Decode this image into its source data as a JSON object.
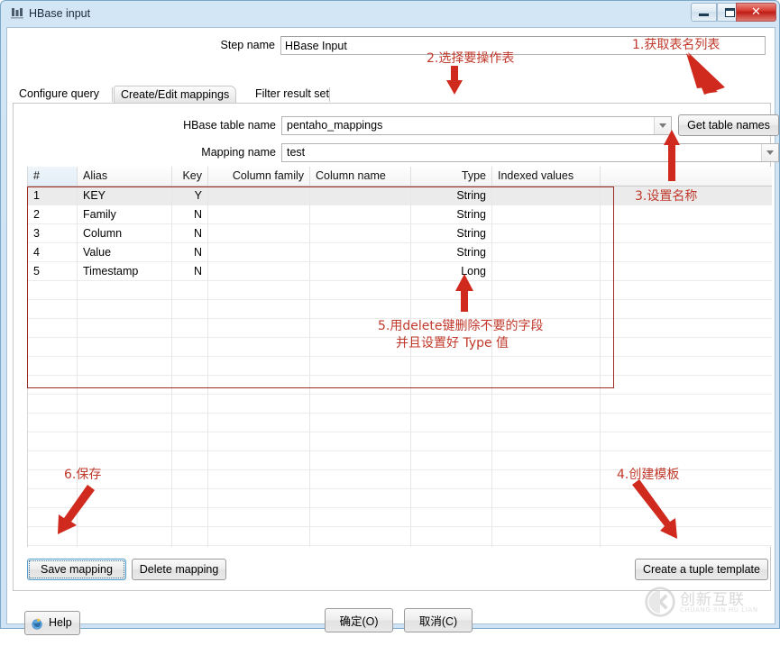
{
  "window": {
    "title": "HBase input",
    "icon": "hbase-step-icon",
    "controls": {
      "minimize": "minimize-icon",
      "maximize": "maximize-icon",
      "close": "close-icon"
    }
  },
  "form": {
    "step_name_label": "Step name",
    "step_name_value": "HBase Input"
  },
  "tabs": [
    {
      "label": "Configure query",
      "active": false
    },
    {
      "label": "Create/Edit mappings",
      "active": true
    },
    {
      "label": "Filter result set",
      "active": false
    }
  ],
  "mapping_panel": {
    "hbase_table_label": "HBase table name",
    "hbase_table_value": "pentaho_mappings",
    "get_table_names_label": "Get table names",
    "mapping_name_label": "Mapping name",
    "mapping_name_value": "test",
    "save_mapping_label": "Save mapping",
    "delete_mapping_label": "Delete mapping",
    "create_tuple_label": "Create a tuple template"
  },
  "grid": {
    "columns": [
      "#",
      "Alias",
      "Key",
      "Column family",
      "Column name",
      "Type",
      "Indexed values"
    ],
    "sorted_column": "#",
    "rows": [
      {
        "num": "1",
        "alias": "KEY",
        "key": "Y",
        "family": "",
        "column": "",
        "type": "String",
        "indexed": "",
        "selected": true
      },
      {
        "num": "2",
        "alias": "Family",
        "key": "N",
        "family": "",
        "column": "",
        "type": "String",
        "indexed": "",
        "selected": false
      },
      {
        "num": "3",
        "alias": "Column",
        "key": "N",
        "family": "",
        "column": "",
        "type": "String",
        "indexed": "",
        "selected": false
      },
      {
        "num": "4",
        "alias": "Value",
        "key": "N",
        "family": "",
        "column": "",
        "type": "String",
        "indexed": "",
        "selected": false
      },
      {
        "num": "5",
        "alias": "Timestamp",
        "key": "N",
        "family": "",
        "column": "",
        "type": "Long",
        "indexed": "",
        "selected": false
      }
    ]
  },
  "dialog_buttons": {
    "help_label": "Help",
    "ok_label": "确定(O)",
    "cancel_label": "取消(C)"
  },
  "annotations": [
    {
      "id": "a1",
      "text": "1.获取表名列表"
    },
    {
      "id": "a2",
      "text": "2.选择要操作表"
    },
    {
      "id": "a3",
      "text": "3.设置名称"
    },
    {
      "id": "a4",
      "text": "4.创建模板"
    },
    {
      "id": "a5",
      "line1": "5.用delete键删除不要的字段",
      "line2": "并且设置好 Type 值"
    },
    {
      "id": "a6",
      "text": "6.保存"
    }
  ],
  "annotation_color": "#c0392b",
  "watermark": {
    "name": "创新互联",
    "pinyin": "CHUANG XIN HU LIAN"
  }
}
